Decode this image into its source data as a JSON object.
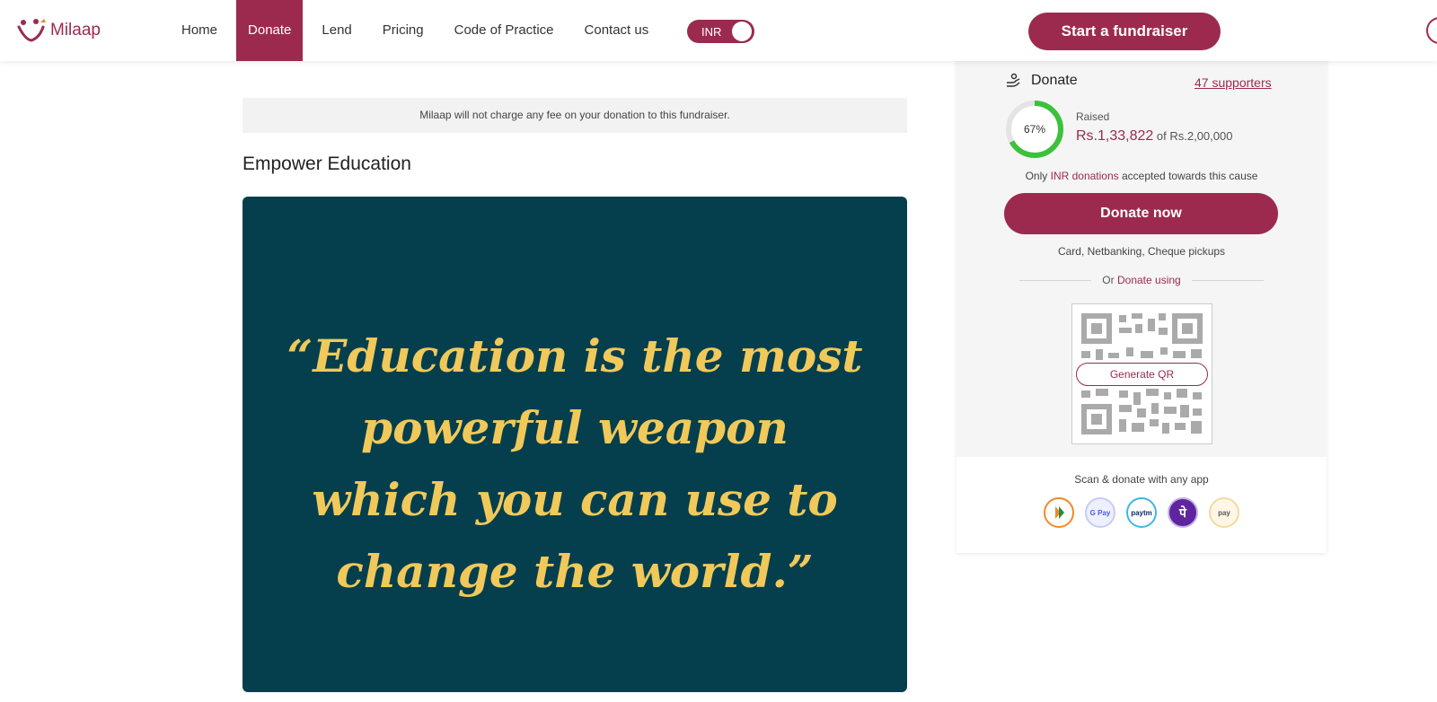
{
  "brand": {
    "name": "Milaap",
    "accent": "#9c2a4f"
  },
  "nav": {
    "items": [
      {
        "label": "Home",
        "active": false
      },
      {
        "label": "Donate",
        "active": true
      },
      {
        "label": "Lend",
        "active": false
      },
      {
        "label": "Pricing",
        "active": false
      },
      {
        "label": "Code of Practice",
        "active": false
      },
      {
        "label": "Contact us",
        "active": false
      }
    ],
    "currency_toggle": "INR",
    "cta": "Start a fundraiser"
  },
  "main": {
    "fee_notice": "Milaap will not charge any fee on your donation to this fundraiser.",
    "campaign_title": "Empower Education",
    "hero_quote_lines": [
      "“Education is the most",
      "powerful weapon",
      "which you can use to",
      "change the world.”"
    ],
    "hero_bg": "#053f4e",
    "hero_text_color": "#f0c95a"
  },
  "donate": {
    "heading": "Donate",
    "supporters": "47 supporters",
    "progress_percent": 67,
    "progress_label": "67%",
    "raised_label": "Raised",
    "raised_amount": "Rs.1,33,822",
    "goal_text": "of Rs.2,00,000",
    "inr_note_prefix": "Only",
    "inr_note_highlight": "INR donations",
    "inr_note_suffix": "accepted towards this cause",
    "donate_button": "Donate now",
    "payment_methods": "Card, Netbanking, Cheque pickups",
    "or_prefix": "Or",
    "or_link": "Donate using",
    "generate_qr": "Generate QR",
    "scan_label": "Scan & donate with any app",
    "apps": [
      {
        "name": "bhim-icon",
        "label": ""
      },
      {
        "name": "gpay-icon",
        "label": "G Pay"
      },
      {
        "name": "paytm-icon",
        "label": "paytm"
      },
      {
        "name": "phonepe-icon",
        "label": "पे"
      },
      {
        "name": "amazonpay-icon",
        "label": "pay"
      }
    ]
  }
}
